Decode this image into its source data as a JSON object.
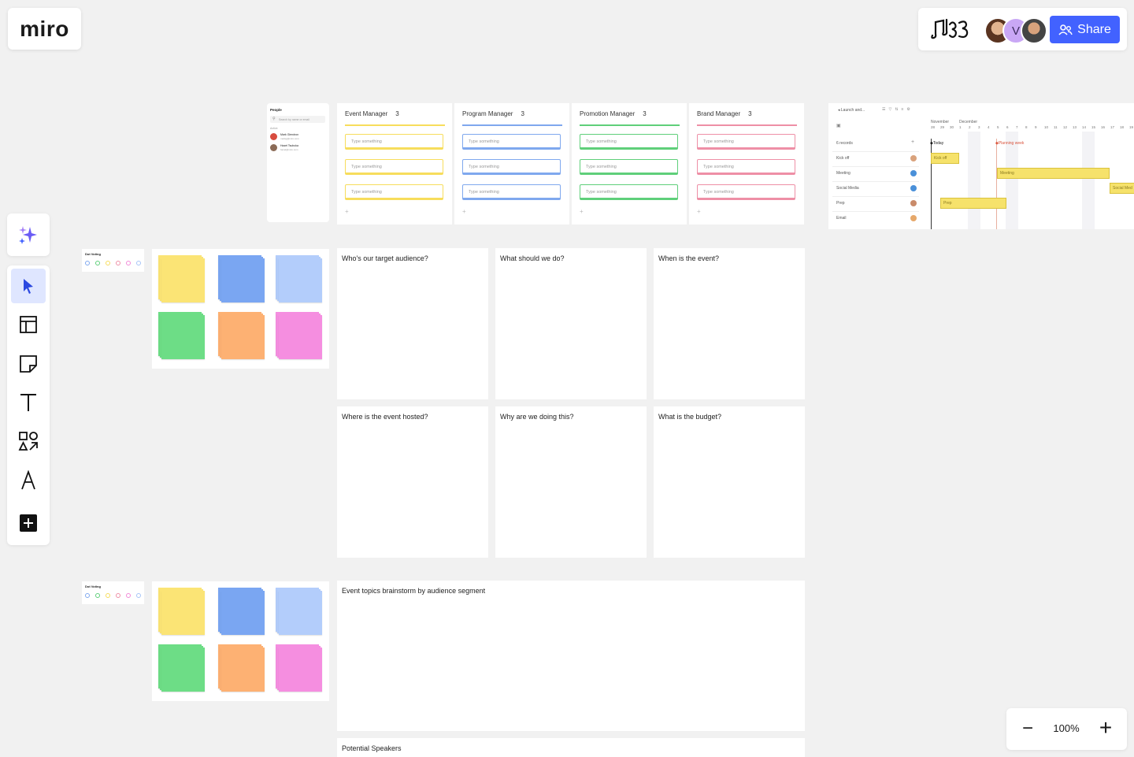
{
  "app": {
    "logo_text": "miro"
  },
  "topbar": {
    "board_icon": "music-notes-icon",
    "avatars": [
      {
        "name": "avatar-1",
        "initial": "",
        "color": "#7a4a2e"
      },
      {
        "name": "avatar-v",
        "initial": "V",
        "color": "#c9a7f5"
      },
      {
        "name": "avatar-3",
        "initial": "",
        "color": "#555555"
      }
    ],
    "share_label": "Share",
    "accent": "#4262ff"
  },
  "toolbar": {
    "items": [
      "ai-sparkle",
      "select",
      "templates",
      "sticky-note",
      "text",
      "shapes",
      "pen",
      "add-more"
    ]
  },
  "people": {
    "title": "People",
    "search_placeholder": "Search by name or email",
    "section": "Active",
    "members": [
      {
        "name": "Mark Glendron",
        "email": "markg@miro.com",
        "color": "#d84c3f"
      },
      {
        "name": "Hazel Tsuboka",
        "email": "hazel@miro.com",
        "color": "#8b6b57"
      }
    ]
  },
  "kanban": [
    {
      "title": "Event Manager",
      "count": "3",
      "color": "#f7dd5c",
      "cards": [
        "Type something",
        "Type something",
        "Type something"
      ],
      "add": "+"
    },
    {
      "title": "Program Manager",
      "count": "3",
      "color": "#7fa8ee",
      "cards": [
        "Type something",
        "Type something",
        "Type something"
      ],
      "add": "+"
    },
    {
      "title": "Promotion Manager",
      "count": "3",
      "color": "#5fcf7a",
      "cards": [
        "Type something",
        "Type something",
        "Type something"
      ],
      "add": "+"
    },
    {
      "title": "Brand Manager",
      "count": "3",
      "color": "#ee8fa6",
      "cards": [
        "Type something",
        "Type something",
        "Type something"
      ],
      "add": "+"
    }
  ],
  "gantt": {
    "title": "Launch and...",
    "records": "6 records",
    "months": [
      "November",
      "December"
    ],
    "days": [
      "28",
      "29",
      "30",
      "1",
      "2",
      "3",
      "4",
      "5",
      "6",
      "7",
      "8",
      "9",
      "10",
      "11",
      "12",
      "13",
      "14",
      "15",
      "16",
      "17",
      "18",
      "19"
    ],
    "today_label": "Today",
    "milestone_label": "Planning week",
    "rows": [
      "Kick off",
      "Meeting",
      "Social Media",
      "Prep",
      "Email"
    ],
    "bars": [
      "Kick off",
      "Meeting",
      "Social Med",
      "Prep"
    ]
  },
  "dot_voting": {
    "title": "Dot Voting",
    "colors": [
      "#7fa8ee",
      "#5fcf7a",
      "#f7dd5c",
      "#ee8fa6",
      "#f28ad8",
      "#a6c4f7"
    ]
  },
  "sticky_colors": [
    "#fbe475",
    "#7aa6f2",
    "#b3cdfb",
    "#6ddd86",
    "#fdb173",
    "#f58ee0"
  ],
  "questions": [
    "Who's our target audience?",
    "What should we do?",
    "When is the event?",
    "Where is the event hosted?",
    "Why are we doing this?",
    "What is the budget?"
  ],
  "brainstorm_title": "Event topics brainstorm by audience segment",
  "speakers_title": "Potential Speakers",
  "zoom": {
    "minus": "−",
    "level": "100%",
    "plus": "+"
  }
}
